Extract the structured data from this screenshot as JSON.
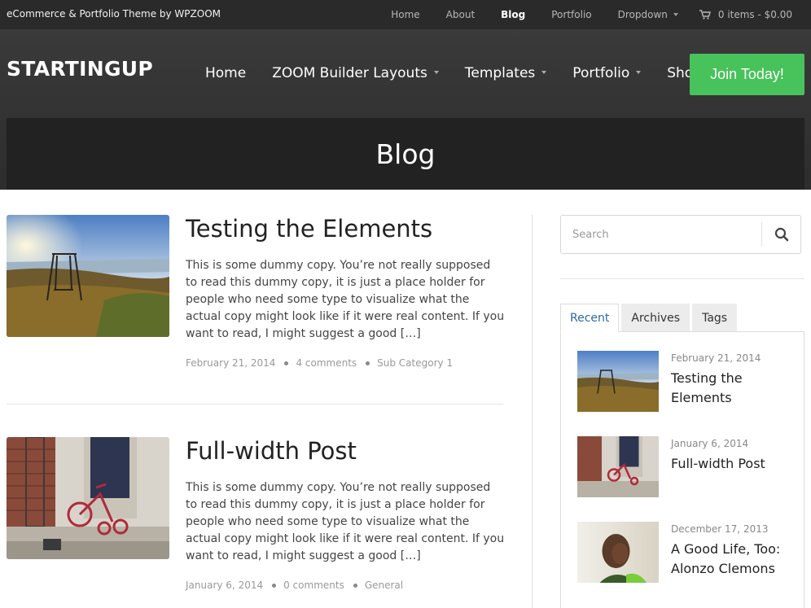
{
  "topbar": {
    "tagline": "eCommerce & Portfolio Theme by WPZOOM",
    "nav": [
      {
        "label": "Home"
      },
      {
        "label": "About"
      },
      {
        "label": "Blog"
      },
      {
        "label": "Portfolio"
      },
      {
        "label": "Dropdown"
      }
    ],
    "cart_label": "0 items - $0.00"
  },
  "header": {
    "logo": "STARTINGUP",
    "nav": [
      {
        "label": "Home"
      },
      {
        "label": "ZOOM Builder Layouts"
      },
      {
        "label": "Templates"
      },
      {
        "label": "Portfolio"
      },
      {
        "label": "Shop"
      }
    ],
    "cta_label": "Join Today!"
  },
  "page_title": "Blog",
  "posts": [
    {
      "title": "Testing the Elements",
      "excerpt": "This is some dummy copy. You’re not really supposed to read this dummy copy, it is just a place holder for people who need some type to visualize what the actual copy might look like if it were real content. If you want to read, I might suggest a good […]",
      "date": "February 21, 2014",
      "comments": "4 comments",
      "category": "Sub Category 1"
    },
    {
      "title": "Full-width Post",
      "excerpt": "This is some dummy copy. You’re not really supposed to read this dummy copy, it is just a place holder for people who need some type to visualize what the actual copy might look like if it were real content. If you want to read, I might suggest a good […]",
      "date": "January 6, 2014",
      "comments": "0 comments",
      "category": "General"
    }
  ],
  "sidebar": {
    "search_placeholder": "Search",
    "tabs": [
      {
        "label": "Recent"
      },
      {
        "label": "Archives"
      },
      {
        "label": "Tags"
      }
    ],
    "recent": [
      {
        "date": "February 21, 2014",
        "title": "Testing the Elements"
      },
      {
        "date": "January 6, 2014",
        "title": "Full-width Post"
      },
      {
        "date": "December 17, 2013",
        "title": "A Good Life, Too: Alonzo Clemons"
      }
    ]
  },
  "colors": {
    "topbar_bg": "#2a2a2b",
    "header_bg": "#333334",
    "cta_green": "#48c25a",
    "active_tab": "#2a6aa8"
  }
}
